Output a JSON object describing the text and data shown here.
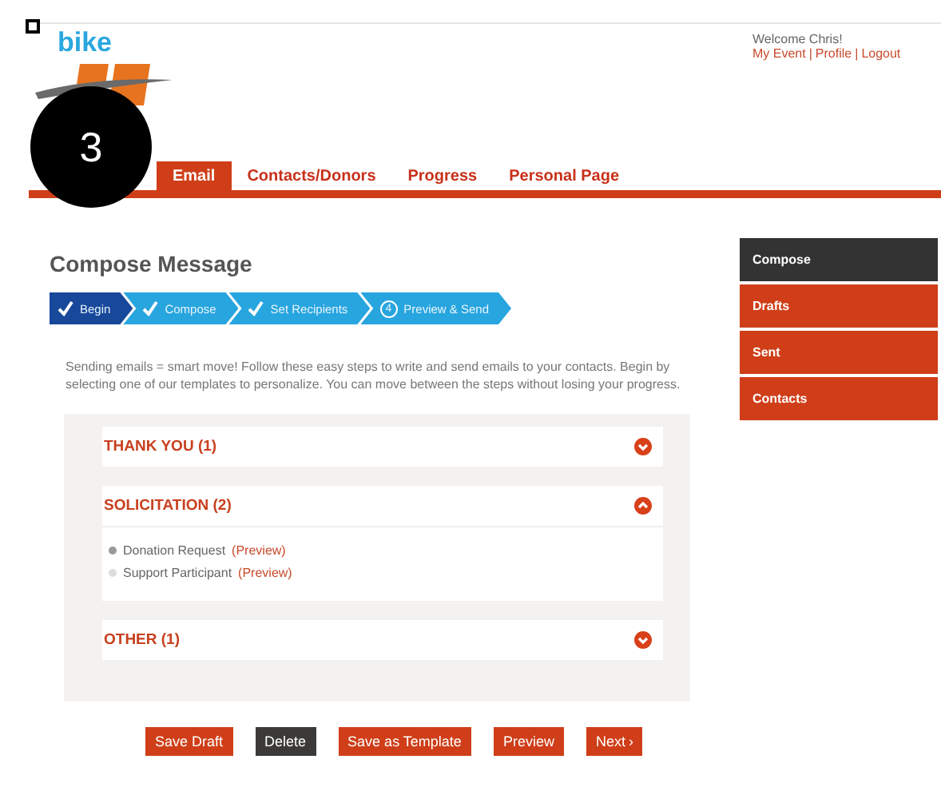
{
  "overlay": {
    "badge": "3"
  },
  "logo": {
    "word": "bike"
  },
  "account": {
    "welcome": "Welcome Chris!",
    "links": [
      "My Event",
      "Profile",
      "Logout"
    ],
    "separator": "|"
  },
  "nav": [
    {
      "label": "Email",
      "selected": true
    },
    {
      "label": "Contacts/Donors",
      "selected": false
    },
    {
      "label": "Progress",
      "selected": false
    },
    {
      "label": "Personal Page",
      "selected": false
    }
  ],
  "title": "Compose Message",
  "steps": [
    {
      "label": "Begin",
      "done": true,
      "selected": true
    },
    {
      "label": "Compose",
      "done": true,
      "selected": false
    },
    {
      "label": "Set Recipients",
      "done": true,
      "selected": false
    },
    {
      "label": "Preview & Send",
      "number": "4",
      "done": false,
      "selected": false
    }
  ],
  "intro": "Sending emails = smart move! Follow these easy steps to write and send emails to your contacts. Begin by selecting one of our templates to personalize. You can move between the steps without losing your progress.",
  "sections": [
    {
      "title": "THANK YOU (1)",
      "expanded": false
    },
    {
      "title": "SOLICITATION (2)",
      "expanded": true,
      "templates": [
        {
          "name": "Donation Request",
          "link": "(Preview)",
          "selected": true
        },
        {
          "name": "Support Participant",
          "link": "(Preview)",
          "selected": false
        }
      ]
    },
    {
      "title": "OTHER (1)",
      "expanded": false
    }
  ],
  "sidebar": [
    {
      "label": "Compose",
      "selected": true
    },
    {
      "label": "Drafts",
      "selected": false
    },
    {
      "label": "Sent",
      "selected": false
    },
    {
      "label": "Contacts",
      "selected": false
    }
  ],
  "buttons": [
    {
      "label": "Save Draft",
      "kind": "primary"
    },
    {
      "label": "Delete",
      "kind": "dark"
    },
    {
      "label": "Save as Template",
      "kind": "primary"
    },
    {
      "label": "Preview",
      "kind": "primary"
    },
    {
      "label": "Next",
      "suffix": "›",
      "kind": "primary"
    }
  ]
}
